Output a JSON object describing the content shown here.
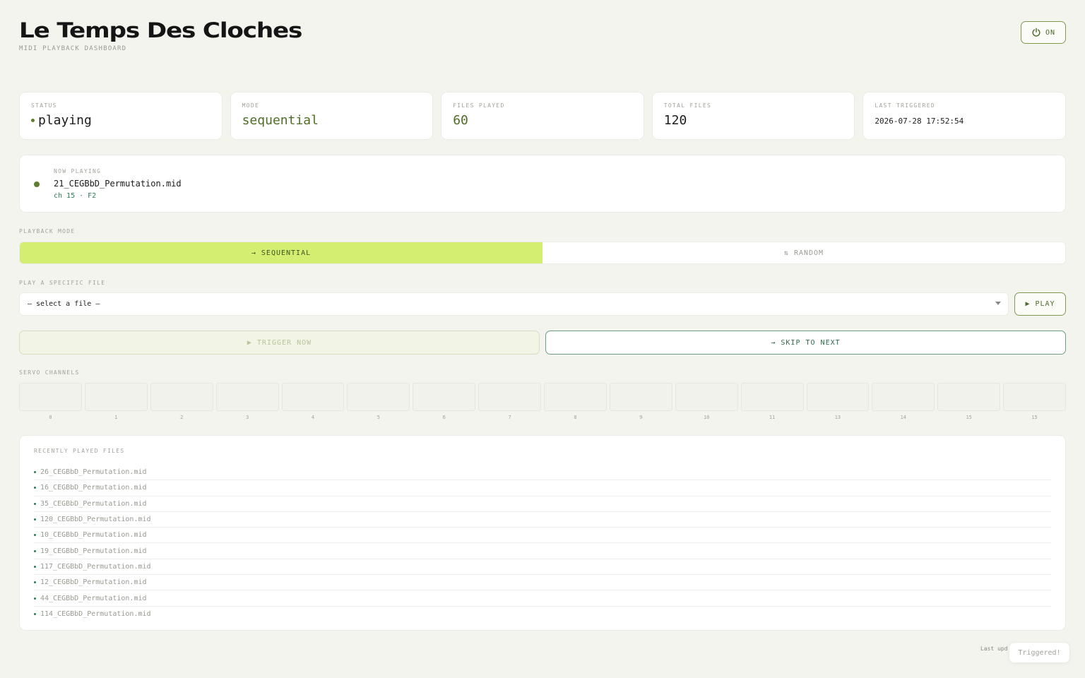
{
  "header": {
    "title": "Le Temps Des Cloches",
    "subtitle": "MIDI PLAYBACK DASHBOARD",
    "power_label": "ON"
  },
  "stats": [
    {
      "label": "STATUS",
      "value": "playing"
    },
    {
      "label": "MODE",
      "value": "sequential"
    },
    {
      "label": "FILES PLAYED",
      "value": "60"
    },
    {
      "label": "TOTAL FILES",
      "value": "120"
    },
    {
      "label": "LAST TRIGGERED",
      "value": "2026-07-28 17:52:54"
    }
  ],
  "now_playing": {
    "label": "NOW PLAYING",
    "file": "21_CEGBbD_Permutation.mid",
    "meta": "ch 15 · F2"
  },
  "playback_mode": {
    "label": "PLAYBACK MODE",
    "sequential": "→ SEQUENTIAL",
    "random": "⇅ RANDOM"
  },
  "specific_file": {
    "label": "PLAY A SPECIFIC FILE",
    "selected": "— select a file —",
    "play_label": "▶ PLAY"
  },
  "actions": {
    "trigger_label": "▶ TRIGGER NOW",
    "skip_label": "→ SKIP TO NEXT"
  },
  "servo": {
    "label": "SERVO CHANNELS",
    "channels": [
      "0",
      "1",
      "2",
      "3",
      "4",
      "5",
      "6",
      "7",
      "8",
      "9",
      "10",
      "11",
      "13",
      "14",
      "15",
      "15"
    ]
  },
  "recent": {
    "label": "RECENTLY PLAYED FILES",
    "items": [
      "26_CEGBbD_Permutation.mid",
      "16_CEGBbD_Permutation.mid",
      "35_CEGBbD_Permutation.mid",
      "120_CEGBbD_Permutation.mid",
      "10_CEGBbD_Permutation.mid",
      "19_CEGBbD_Permutation.mid",
      "117_CEGBbD_Permutation.mid",
      "12_CEGBbD_Permutation.mid",
      "44_CEGBbD_Permutation.mid",
      "114_CEGBbD_Permutation.mid"
    ]
  },
  "footer": {
    "last_updated": "Last upd",
    "toast": "Triggered!"
  },
  "colors": {
    "accent": "#d4ee72",
    "green": "#5e7d2e",
    "teal": "#2f7a57",
    "background": "#f4f4ef"
  },
  "icons": {
    "power": "power-icon"
  }
}
